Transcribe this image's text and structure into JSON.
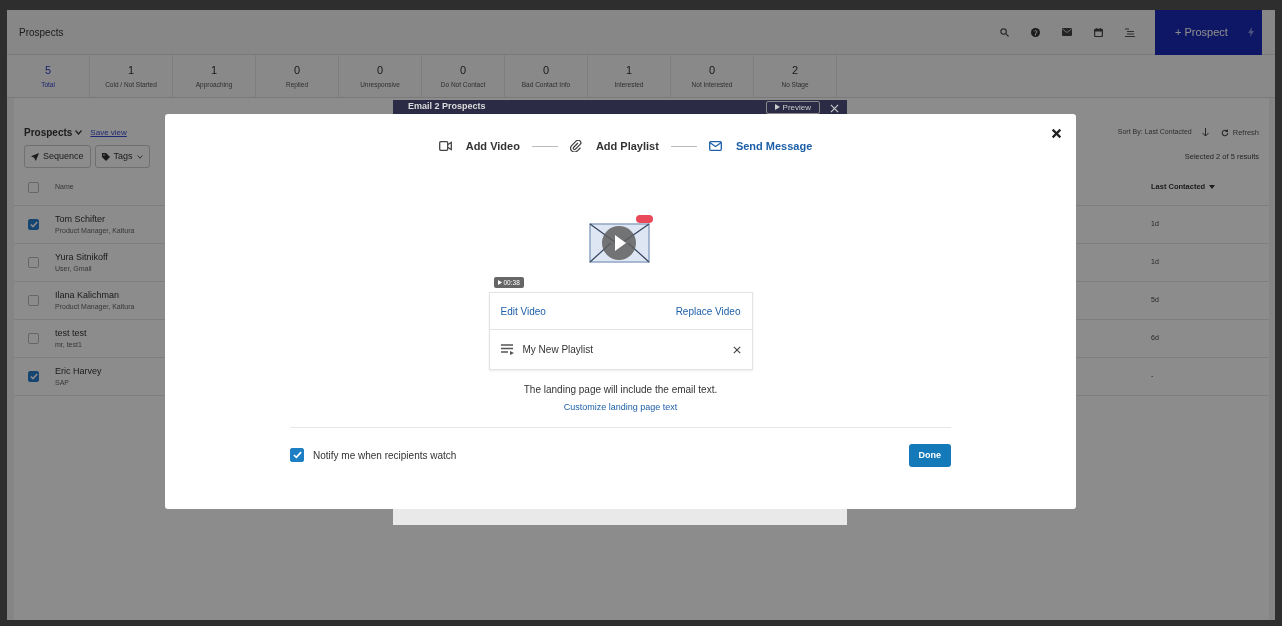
{
  "header": {
    "title": "Prospects",
    "new_prospect": "+ Prospect"
  },
  "stages": [
    {
      "count": "5",
      "label": "Total",
      "selected": true
    },
    {
      "count": "1",
      "label": "Cold / Not Started",
      "selected": false
    },
    {
      "count": "1",
      "label": "Approaching",
      "selected": false
    },
    {
      "count": "0",
      "label": "Replied",
      "selected": false
    },
    {
      "count": "0",
      "label": "Unresponsive",
      "selected": false
    },
    {
      "count": "0",
      "label": "Do Not Contact",
      "selected": false
    },
    {
      "count": "0",
      "label": "Bad Contact Info",
      "selected": false
    },
    {
      "count": "1",
      "label": "Interested",
      "selected": false
    },
    {
      "count": "0",
      "label": "Not Interested",
      "selected": false
    },
    {
      "count": "2",
      "label": "No Stage",
      "selected": false
    }
  ],
  "list": {
    "select_all_checked": false,
    "title": "Prospects",
    "save_view": "Save view",
    "sequence": "Sequence",
    "tags": "Tags",
    "sort": "Sort By: Last Contacted",
    "refresh": "Refresh",
    "selection_info": "Selected 2 of 5 results",
    "columns": [
      "Name",
      "Last Contacted"
    ],
    "rows": [
      {
        "name": "Tom Schifter",
        "subtitle": "Product Manager, Kaltura",
        "last_contacted": "1d",
        "checked": true
      },
      {
        "name": "Yura Sitnikoff",
        "subtitle": "User, Gmail",
        "last_contacted": "1d",
        "checked": false
      },
      {
        "name": "Ilana Kalichman",
        "subtitle": "Product Manager, Kaltura",
        "last_contacted": "5d",
        "checked": false
      },
      {
        "name": "test test",
        "subtitle": "mr, test1",
        "last_contacted": "6d",
        "checked": false
      },
      {
        "name": "Eric Harvey",
        "subtitle": "SAP",
        "last_contacted": "-",
        "checked": true
      }
    ]
  },
  "compose_dialog": {
    "title": "Email 2 Prospects",
    "preview": "Preview"
  },
  "video_modal": {
    "steps": [
      {
        "label": "Add Video",
        "kind": "video",
        "selected": false
      },
      {
        "label": "Add Playlist",
        "kind": "playlist",
        "selected": false
      },
      {
        "label": "Send Message",
        "kind": "message",
        "selected": true
      }
    ],
    "duration": "00:38",
    "edit_video": "Edit Video",
    "replace_video": "Replace Video",
    "playlist": "My New Playlist",
    "landing_note": "The landing page will include the email text.",
    "customize_link": "Customize landing page text",
    "notify": {
      "label": "Notify me when recipients watch",
      "checked": true
    },
    "done": "Done"
  }
}
